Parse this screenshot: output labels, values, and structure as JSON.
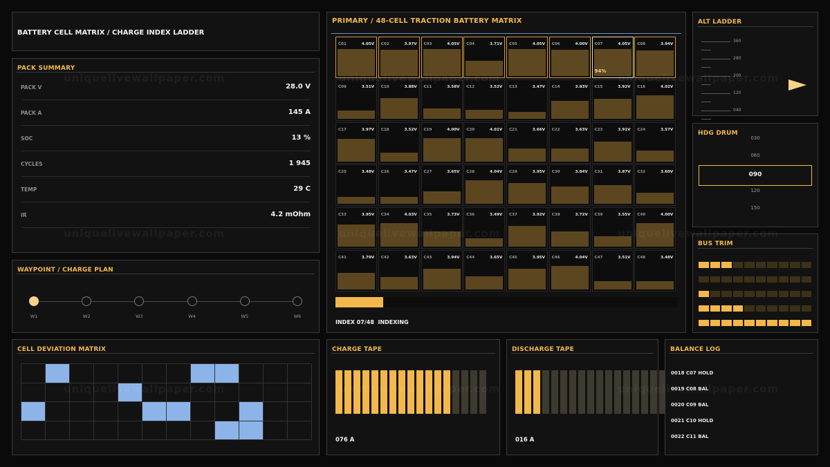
{
  "header": {
    "title": "BATTERY CELL MATRIX / CHARGE INDEX LADDER"
  },
  "pack_summary": {
    "title": "PACK SUMMARY",
    "rows": [
      {
        "label": "PACK V",
        "value": "28.0 V"
      },
      {
        "label": "PACK A",
        "value": "145 A"
      },
      {
        "label": "SOC",
        "value": "13 %"
      },
      {
        "label": "CYCLES",
        "value": "1 945"
      },
      {
        "label": "TEMP",
        "value": "29 C"
      },
      {
        "label": "IR",
        "value": "4.2 mOhm"
      }
    ]
  },
  "waypoint": {
    "title": "WAYPOINT / CHARGE PLAN",
    "points": [
      "W1",
      "W2",
      "W3",
      "W4",
      "W5",
      "W6"
    ],
    "active_index": 0
  },
  "deviation": {
    "title": "CELL DEVIATION MATRIX",
    "on_cells": [
      [
        0,
        1
      ],
      [
        0,
        7
      ],
      [
        0,
        8
      ],
      [
        1,
        4
      ],
      [
        2,
        0
      ],
      [
        2,
        5
      ],
      [
        2,
        6
      ],
      [
        2,
        9
      ],
      [
        3,
        8
      ],
      [
        3,
        9
      ]
    ]
  },
  "matrix": {
    "title": "PRIMARY / 48-CELL TRACTION BATTERY MATRIX",
    "cells": [
      {
        "id": "C01",
        "v": "4.05V",
        "fill": 0.92
      },
      {
        "id": "C02",
        "v": "3.97V",
        "fill": 0.9
      },
      {
        "id": "C03",
        "v": "4.05V",
        "fill": 0.92
      },
      {
        "id": "C04",
        "v": "3.71V",
        "fill": 0.52
      },
      {
        "id": "C05",
        "v": "4.05V",
        "fill": 0.92
      },
      {
        "id": "C06",
        "v": "4.00V",
        "fill": 0.9
      },
      {
        "id": "C07",
        "v": "4.05V",
        "fill": 0.92,
        "pct": "94%"
      },
      {
        "id": "C08",
        "v": "3.94V",
        "fill": 0.88
      },
      {
        "id": "C09",
        "v": "3.51V",
        "fill": 0.28
      },
      {
        "id": "C10",
        "v": "3.88V",
        "fill": 0.72
      },
      {
        "id": "C11",
        "v": "3.58V",
        "fill": 0.35
      },
      {
        "id": "C12",
        "v": "3.52V",
        "fill": 0.3
      },
      {
        "id": "C13",
        "v": "3.47V",
        "fill": 0.24
      },
      {
        "id": "C14",
        "v": "3.83V",
        "fill": 0.62
      },
      {
        "id": "C15",
        "v": "3.92V",
        "fill": 0.7
      },
      {
        "id": "C16",
        "v": "4.02V",
        "fill": 0.8
      },
      {
        "id": "C17",
        "v": "3.97V",
        "fill": 0.78
      },
      {
        "id": "C18",
        "v": "3.52V",
        "fill": 0.32
      },
      {
        "id": "C19",
        "v": "4.00V",
        "fill": 0.8
      },
      {
        "id": "C20",
        "v": "4.01V",
        "fill": 0.8
      },
      {
        "id": "C21",
        "v": "3.66V",
        "fill": 0.45
      },
      {
        "id": "C22",
        "v": "3.63V",
        "fill": 0.45
      },
      {
        "id": "C23",
        "v": "3.91V",
        "fill": 0.7
      },
      {
        "id": "C24",
        "v": "3.57V",
        "fill": 0.38
      },
      {
        "id": "C25",
        "v": "3.48V",
        "fill": 0.24
      },
      {
        "id": "C26",
        "v": "3.47V",
        "fill": 0.24
      },
      {
        "id": "C27",
        "v": "3.65V",
        "fill": 0.42
      },
      {
        "id": "C28",
        "v": "4.04V",
        "fill": 0.82
      },
      {
        "id": "C29",
        "v": "3.95V",
        "fill": 0.72
      },
      {
        "id": "C30",
        "v": "3.84V",
        "fill": 0.6
      },
      {
        "id": "C31",
        "v": "3.87V",
        "fill": 0.65
      },
      {
        "id": "C32",
        "v": "3.60V",
        "fill": 0.38
      },
      {
        "id": "C33",
        "v": "3.95V",
        "fill": 0.75
      },
      {
        "id": "C34",
        "v": "4.03V",
        "fill": 0.8
      },
      {
        "id": "C35",
        "v": "3.73V",
        "fill": 0.52
      },
      {
        "id": "C36",
        "v": "3.49V",
        "fill": 0.28
      },
      {
        "id": "C37",
        "v": "3.92V",
        "fill": 0.72
      },
      {
        "id": "C38",
        "v": "3.72V",
        "fill": 0.52
      },
      {
        "id": "C39",
        "v": "3.55V",
        "fill": 0.35
      },
      {
        "id": "C40",
        "v": "4.00V",
        "fill": 0.8
      },
      {
        "id": "C41",
        "v": "3.79V",
        "fill": 0.58
      },
      {
        "id": "C42",
        "v": "3.63V",
        "fill": 0.42
      },
      {
        "id": "C43",
        "v": "3.94V",
        "fill": 0.72
      },
      {
        "id": "C44",
        "v": "3.65V",
        "fill": 0.45
      },
      {
        "id": "C45",
        "v": "3.95V",
        "fill": 0.72
      },
      {
        "id": "C46",
        "v": "4.04V",
        "fill": 0.8
      },
      {
        "id": "C47",
        "v": "3.51V",
        "fill": 0.28
      },
      {
        "id": "C48",
        "v": "3.48V",
        "fill": 0.28
      }
    ],
    "highlighted": [
      0,
      1,
      2,
      3,
      4,
      5,
      7
    ],
    "selected": 6,
    "progress": 0.14,
    "status": "INDEX 07/48  INDEXING"
  },
  "alt_ladder": {
    "title": "ALT LADDER",
    "labels": [
      "360",
      "280",
      "200",
      "120",
      "040"
    ]
  },
  "hdg_drum": {
    "title": "HDG DRUM",
    "labels": [
      "030",
      "060",
      "090",
      "120",
      "150"
    ],
    "current": "090"
  },
  "bus_trim": {
    "title": "BUS TRIM",
    "rows_on": [
      3,
      0,
      1,
      4,
      10
    ],
    "cells_per_row": 10
  },
  "charge_tape": {
    "title": "CHARGE TAPE",
    "value": "076 A",
    "on": 13,
    "total": 17
  },
  "discharge_tape": {
    "title": "DISCHARGE TAPE",
    "value": "016 A",
    "on": 3,
    "total": 17
  },
  "balance_log": {
    "title": "BALANCE LOG",
    "entries": [
      "0018 C07 HOLD",
      "0019 C08 BAL",
      "0020 C09 BAL",
      "0021 C10 HOLD",
      "0022 C11 BAL"
    ]
  },
  "watermark": "uniquelivewallpaper.com",
  "colors": {
    "accent": "#f2b84b",
    "blue": "#8db4e8",
    "fill": "#5c4620",
    "bg": "#0a0a0a"
  }
}
